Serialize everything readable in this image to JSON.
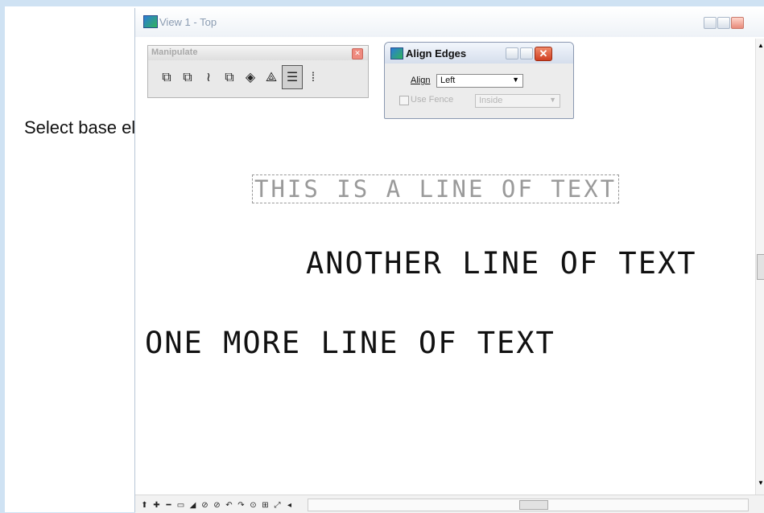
{
  "annotation": {
    "label": "Select base element"
  },
  "view_window": {
    "title": "View 1 - Top",
    "drawing_lines": [
      "THIS IS A LINE OF TEXT",
      "ANOTHER LINE OF TEXT",
      "ONE MORE LINE OF TEXT"
    ]
  },
  "manipulate_toolbar": {
    "title": "Manipulate",
    "tools": [
      {
        "icon": "copy-tool-icon",
        "glyph": "⧉"
      },
      {
        "icon": "move-tool-icon",
        "glyph": "⧉"
      },
      {
        "icon": "array-tool-icon",
        "glyph": "≀"
      },
      {
        "icon": "scale-tool-icon",
        "glyph": "⧉"
      },
      {
        "icon": "rotate-tool-icon",
        "glyph": "◈"
      },
      {
        "icon": "mirror-tool-icon",
        "glyph": "⟁"
      },
      {
        "icon": "align-edges-tool-icon",
        "glyph": "☰",
        "selected": true
      },
      {
        "icon": "stretch-tool-icon",
        "glyph": "⁞"
      }
    ]
  },
  "align_edges_dialog": {
    "title": "Align Edges",
    "align_label": "Align",
    "align_value": "Left",
    "use_fence_label": "Use Fence",
    "fence_mode_value": "Inside"
  },
  "bottom_bar_icons": [
    "⬆",
    "✚",
    "━",
    "▭",
    "◢",
    "⊘",
    "⊘",
    "↶",
    "↷",
    "⊙",
    "⊞",
    "⤢",
    "◂"
  ]
}
